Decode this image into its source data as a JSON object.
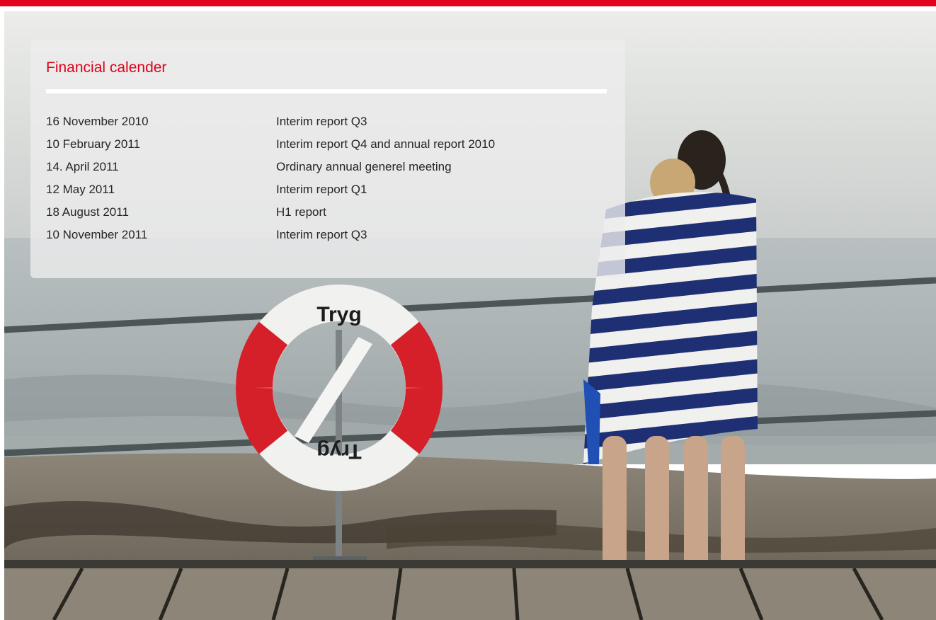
{
  "colors": {
    "accent": "#e2001a",
    "text": "#262626",
    "panel": "#ececec"
  },
  "calendar": {
    "title": "Financial calender",
    "entries": [
      {
        "date": "16 November 2010",
        "event": "Interim report Q3"
      },
      {
        "date": "10 February 2011",
        "event": "Interim report Q4 and annual report 2010"
      },
      {
        "date": "14. April 2011",
        "event": "Ordinary annual generel meeting"
      },
      {
        "date": "12 May 2011",
        "event": "Interim report Q1"
      },
      {
        "date": "18 August 2011",
        "event": "H1 report"
      },
      {
        "date": "10 November 2011",
        "event": "Interim report Q3"
      }
    ]
  },
  "photo": {
    "buoy_text": "Tryg",
    "buoy_text_inverted": "Tryg"
  }
}
